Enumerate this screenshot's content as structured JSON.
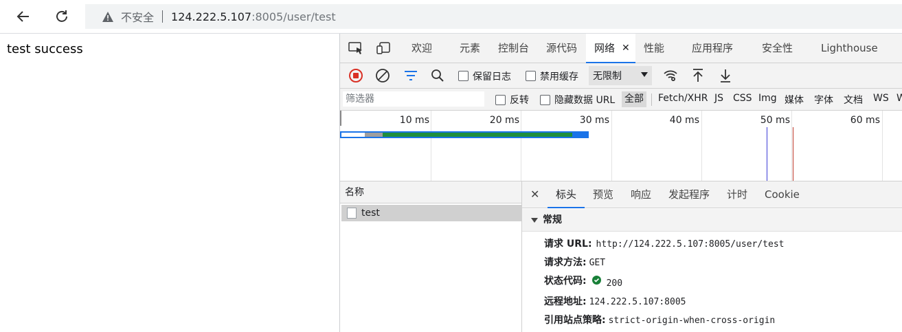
{
  "browser": {
    "security_label": "不安全",
    "url_host": "124.222.5.107",
    "url_path": ":8005/user/test"
  },
  "page": {
    "body_text": "test success"
  },
  "devtools": {
    "tabs": [
      {
        "label": "欢迎"
      },
      {
        "label": "元素"
      },
      {
        "label": "控制台"
      },
      {
        "label": "源代码"
      },
      {
        "label": "网络"
      },
      {
        "label": "性能"
      },
      {
        "label": "应用程序"
      },
      {
        "label": "安全性"
      },
      {
        "label": "Lighthouse"
      }
    ],
    "active_tab": "网络",
    "toolbar": {
      "preserve_log": "保留日志",
      "disable_cache": "禁用缓存",
      "throttle": "无限制"
    },
    "filter": {
      "placeholder": "筛选器",
      "invert": "反转",
      "hide_data_urls": "隐藏数据 URL",
      "all": "全部",
      "types": [
        "Fetch/XHR",
        "JS",
        "CSS",
        "Img",
        "媒体",
        "字体",
        "文档",
        "WS",
        "W"
      ]
    },
    "timeline": {
      "ticks": [
        "10 ms",
        "20 ms",
        "30 ms",
        "40 ms",
        "50 ms",
        "60 ms"
      ]
    },
    "requests": {
      "name_header": "名称",
      "rows": [
        {
          "name": "test"
        }
      ]
    },
    "detail": {
      "tabs": [
        "标头",
        "预览",
        "响应",
        "发起程序",
        "计时",
        "Cookie"
      ],
      "active": "标头",
      "section": "常规",
      "general": {
        "request_url_label": "请求 URL:",
        "request_url": "http://124.222.5.107:8005/user/test",
        "method_label": "请求方法:",
        "method": "GET",
        "status_label": "状态代码:",
        "status": "200",
        "remote_label": "远程地址:",
        "remote": "124.222.5.107:8005",
        "referrer_label": "引用站点策略:",
        "referrer": "strict-origin-when-cross-origin"
      }
    }
  },
  "colors": {
    "accent": "#1a73e8",
    "status_ok": "#188038",
    "record": "#d93025"
  }
}
